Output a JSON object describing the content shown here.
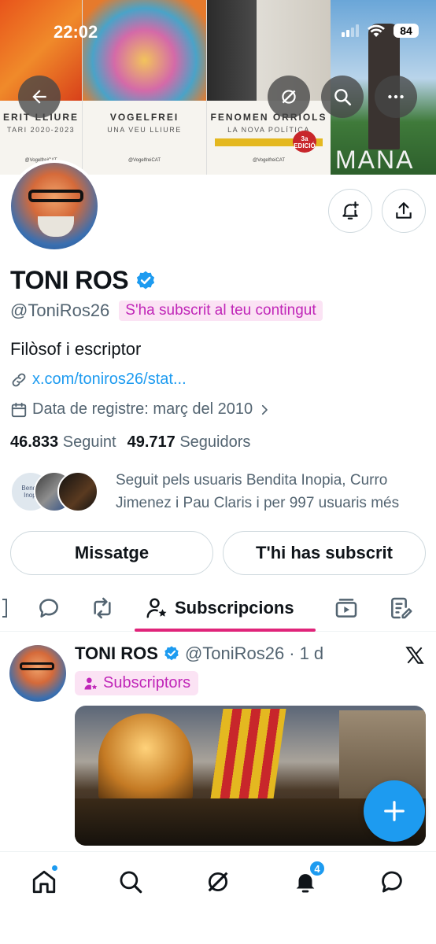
{
  "status_bar": {
    "time": "22:02",
    "battery": "84"
  },
  "banner": {
    "covers": [
      {
        "title": "ERIT LLIURE",
        "subtitle": "TARI 2020-2023",
        "credit": "@VogelfreiCAT"
      },
      {
        "title": "VOGELFREI",
        "subtitle": "UNA VEU LLIURE",
        "credit": "@VogelfreiCAT"
      },
      {
        "title": "FENOMEN ORRIOLS",
        "subtitle": "LA NOVA POLÍTICA",
        "credit": "@VogelfreiCAT",
        "badge": "3a EDICIÓ"
      },
      {
        "title": "MANA"
      }
    ]
  },
  "profile": {
    "name": "TONI ROS",
    "handle": "@ToniRos26",
    "subscribed_tag": "S'ha subscrit al teu contingut",
    "bio": "Filòsof i escriptor",
    "link": "x.com/toniros26/stat...",
    "joined": "Data de registre: març del 2010",
    "following_count": "46.833",
    "following_label": "Seguint",
    "followers_count": "49.717",
    "followers_label": "Seguidors",
    "followed_by": "Seguit pels usuaris Bendita Inopia, Curro Jimenez i Pau Claris i per 997 usuaris més",
    "follower_avatar_text": "Bendita Inopia"
  },
  "actions": {
    "message": "Missatge",
    "subscribed": "T'hi has subscrit"
  },
  "tabs": {
    "active": "Subscripcions"
  },
  "post": {
    "name": "TONI ROS",
    "handle": "@ToniRos26",
    "separator": "·",
    "time": "1 d",
    "tag": "Subscriptors"
  },
  "bottom_nav": {
    "notifications_count": "4"
  },
  "colors": {
    "accent": "#1d9bf0",
    "tab_underline": "#e0247a",
    "subscriber_pink": "#c026b8"
  }
}
